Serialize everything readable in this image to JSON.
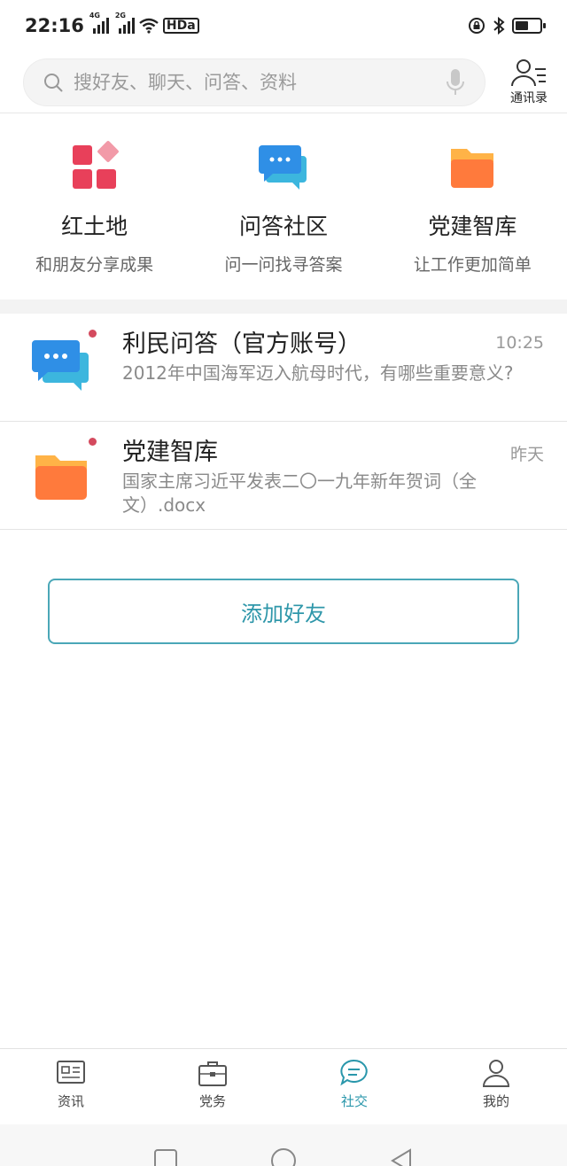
{
  "status": {
    "time": "22:16",
    "sig1": "4G",
    "sig2": "2G",
    "hd": "HDa"
  },
  "search": {
    "placeholder": "搜好友、聊天、问答、资料"
  },
  "contacts": {
    "label": "通讯录"
  },
  "features": [
    {
      "title": "红土地",
      "subtitle": "和朋友分享成果"
    },
    {
      "title": "问答社区",
      "subtitle": "问一问找寻答案"
    },
    {
      "title": "党建智库",
      "subtitle": "让工作更加简单"
    }
  ],
  "messages": [
    {
      "title": "利民问答（官方账号）",
      "time": "10:25",
      "preview": "2012年中国海军迈入航母时代，有哪些重要意义?"
    },
    {
      "title": "党建智库",
      "time": "昨天",
      "preview": "国家主席习近平发表二〇一九年新年贺词（全文）.docx"
    }
  ],
  "add_friend_label": "添加好友",
  "tabs": [
    {
      "label": "资讯"
    },
    {
      "label": "党务"
    },
    {
      "label": "社交"
    },
    {
      "label": "我的"
    }
  ],
  "colors": {
    "accent": "#2a97ab",
    "unread_dot": "#d44a5e",
    "chat_blue": "#2f9be6",
    "folder_orange": "#ff7a3c",
    "tile_red": "#e8405a"
  }
}
